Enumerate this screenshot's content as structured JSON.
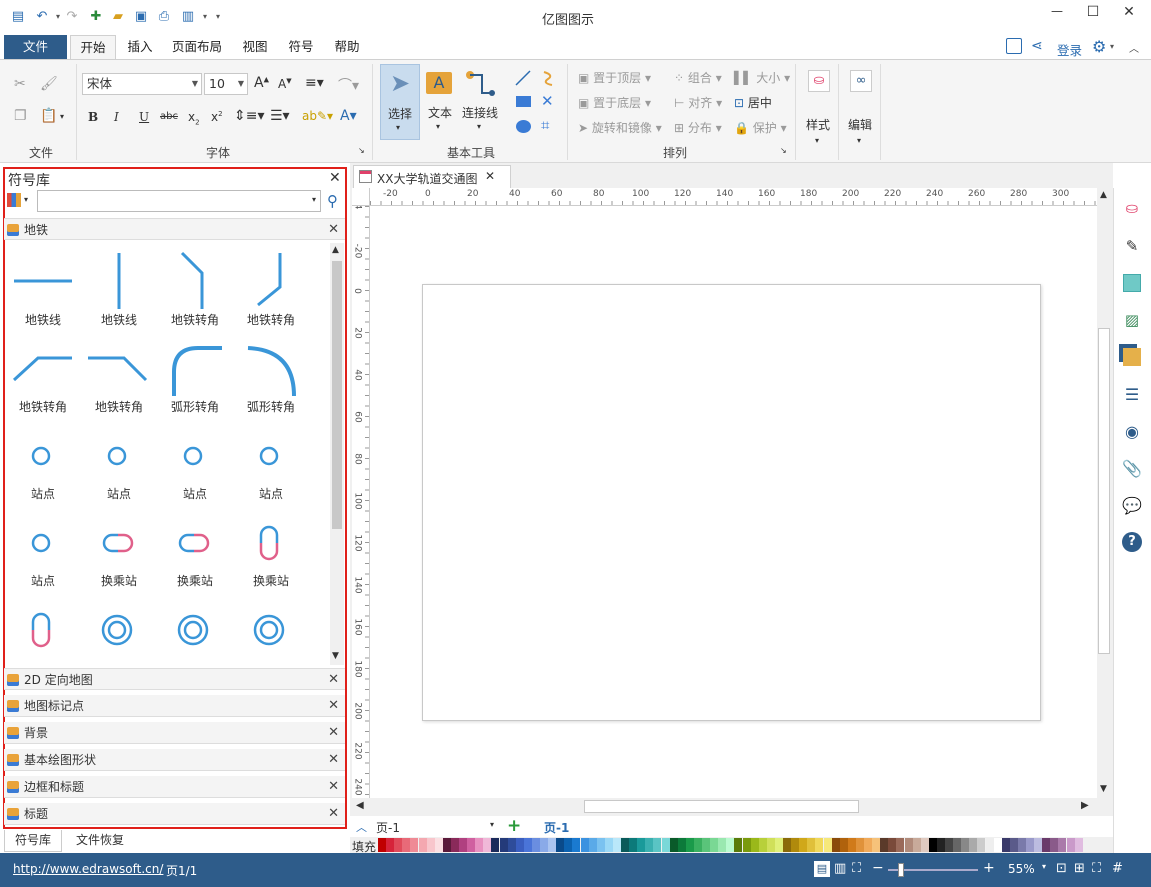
{
  "window": {
    "title": "亿图图示",
    "minimize": "—",
    "maximize": "☐",
    "close": "✕"
  },
  "menu": {
    "file": "文件",
    "tabs": [
      "开始",
      "插入",
      "页面布局",
      "视图",
      "符号",
      "帮助"
    ],
    "login": "登录"
  },
  "ribbon": {
    "groups": {
      "file": "文件",
      "font": "字体",
      "basic_tools": "基本工具",
      "arrange": "排列"
    },
    "font_name": "宋体",
    "font_size": "10",
    "tools": {
      "select": "选择",
      "text": "文本",
      "connector": "连接线"
    },
    "arrange": {
      "bring_top": "置于顶层",
      "send_bottom": "置于底层",
      "rotate_flip": "旋转和镜像",
      "group": "组合",
      "align": "对齐",
      "distribute": "分布",
      "size": "大小",
      "center": "居中",
      "protect": "保护"
    },
    "style": "样式",
    "edit": "编辑"
  },
  "library": {
    "title": "符号库",
    "search_placeholder": "",
    "open_category": "地铁",
    "shapes": [
      {
        "label": "地铁线",
        "icon": "subway-line-h-icon"
      },
      {
        "label": "地铁线",
        "icon": "subway-line-v-icon"
      },
      {
        "label": "地铁转角",
        "icon": "subway-corner-1-icon"
      },
      {
        "label": "地铁转角",
        "icon": "subway-corner-2-icon"
      },
      {
        "label": "地铁转角",
        "icon": "subway-corner-3-icon"
      },
      {
        "label": "地铁转角",
        "icon": "subway-corner-4-icon"
      },
      {
        "label": "弧形转角",
        "icon": "arc-corner-1-icon"
      },
      {
        "label": "弧形转角",
        "icon": "arc-corner-2-icon"
      },
      {
        "label": "站点",
        "icon": "station-icon"
      },
      {
        "label": "站点",
        "icon": "station-icon"
      },
      {
        "label": "站点",
        "icon": "station-icon"
      },
      {
        "label": "站点",
        "icon": "station-icon"
      },
      {
        "label": "站点",
        "icon": "station-icon"
      },
      {
        "label": "换乘站",
        "icon": "transfer-h-icon"
      },
      {
        "label": "换乘站",
        "icon": "transfer-h-icon"
      },
      {
        "label": "换乘站",
        "icon": "transfer-v-icon"
      },
      {
        "label": "",
        "icon": "transfer-v-icon"
      },
      {
        "label": "",
        "icon": "double-ring-icon"
      },
      {
        "label": "",
        "icon": "double-ring-icon"
      },
      {
        "label": "",
        "icon": "double-ring-icon"
      }
    ],
    "categories": [
      "2D 定向地图",
      "地图标记点",
      "背景",
      "基本绘图形状",
      "边框和标题",
      "标题"
    ],
    "bottom_tabs": [
      "符号库",
      "文件恢复"
    ]
  },
  "document": {
    "tab_title": "XX大学轨道交通图",
    "ruler_h": [
      "-20",
      "0",
      "20",
      "40",
      "60",
      "80",
      "100",
      "120",
      "140",
      "160",
      "180",
      "200",
      "220",
      "240",
      "260",
      "280",
      "300"
    ],
    "ruler_v": [
      "-4",
      "-20",
      "0",
      "20",
      "40",
      "60",
      "80",
      "100",
      "120",
      "140",
      "160",
      "180",
      "200",
      "220",
      "240"
    ],
    "page_selector": "页-1",
    "page_tab": "页-1",
    "fill_label": "填充"
  },
  "status": {
    "url": "http://www.edrawsoft.cn/",
    "page": "页1/1",
    "zoom": "55%"
  },
  "colors": {
    "accent": "#2e5c8a",
    "shape_blue": "#3a96d8",
    "shape_pink": "#e0608a",
    "highlight": "#e0201a"
  }
}
